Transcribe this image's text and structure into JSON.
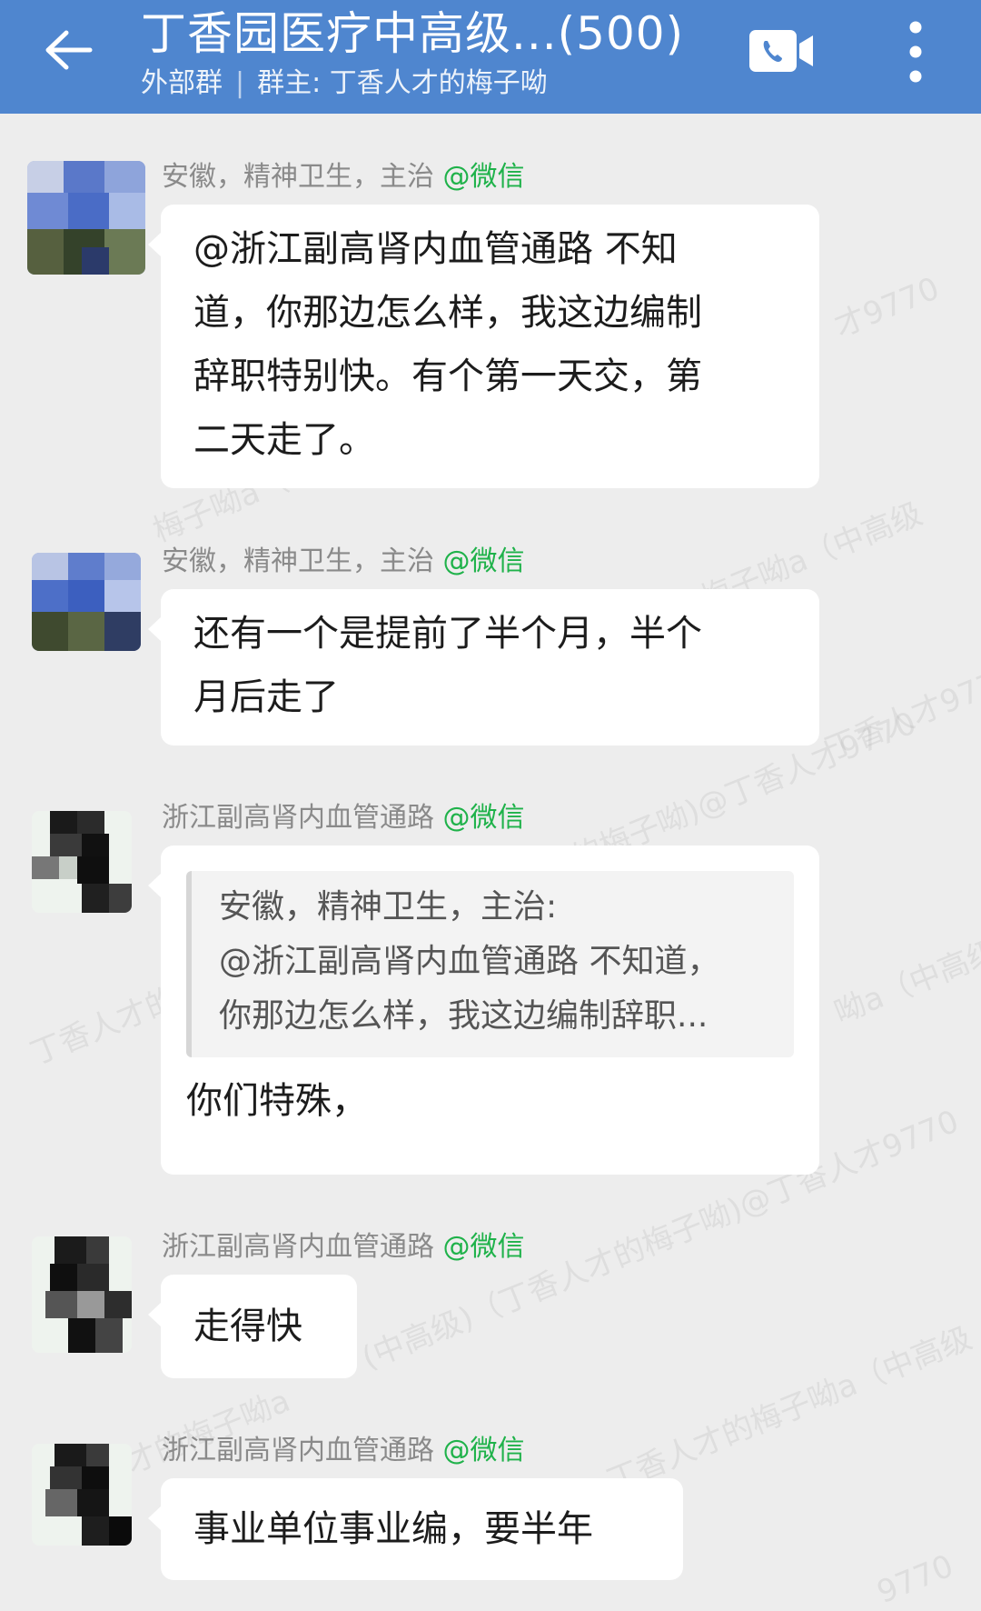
{
  "header": {
    "title": "丁香园医疗中高级...(500)",
    "group_type": "外部群",
    "owner": "群主: 丁香人才的梅子呦"
  },
  "messages": [
    {
      "sender": "安徽，精神卫生，主治",
      "platform": "@微信",
      "lines": [
        "@浙江副高肾内血管通路 不知",
        "道，你那边怎么样，我这边编制",
        "辞职特别快。有个第一天交，第",
        "二天走了。"
      ]
    },
    {
      "sender": "安徽，精神卫生，主治",
      "platform": "@微信",
      "lines": [
        "还有一个是提前了半个月，半个",
        "月后走了"
      ]
    },
    {
      "sender": "浙江副高肾内血管通路",
      "platform": "@微信",
      "quote_lines": [
        "安徽，精神卫生，主治:",
        "@浙江副高肾内血管通路 不知道，",
        "你那边怎么样，我这边编制辞职..."
      ],
      "lines": [
        "你们特殊，"
      ]
    },
    {
      "sender": "浙江副高肾内血管通路",
      "platform": "@微信",
      "lines": [
        "走得快"
      ]
    },
    {
      "sender": "浙江副高肾内血管通路",
      "platform": "@微信",
      "lines": [
        "事业单位事业编，要半年"
      ]
    }
  ],
  "watermarks": [
    "才9770",
    "梅子呦a（中高级",
    "才的梅子呦a（中高级",
    "丁香人才9770",
    "的梅子呦)@丁香人才9770",
    "丁香人才的",
    "呦a（中高级",
    "(中高级)（丁香人才的梅子呦)@丁香人才9770",
    "才的梅子呦a",
    "丁香人才的梅子呦a（中高级",
    "9770"
  ],
  "colors": {
    "header_bg": "#4f86cf",
    "page_bg": "#ededed",
    "bubble_bg": "#ffffff",
    "sender_gray": "#8a8a8a",
    "wechat_green": "#1fb24a"
  }
}
